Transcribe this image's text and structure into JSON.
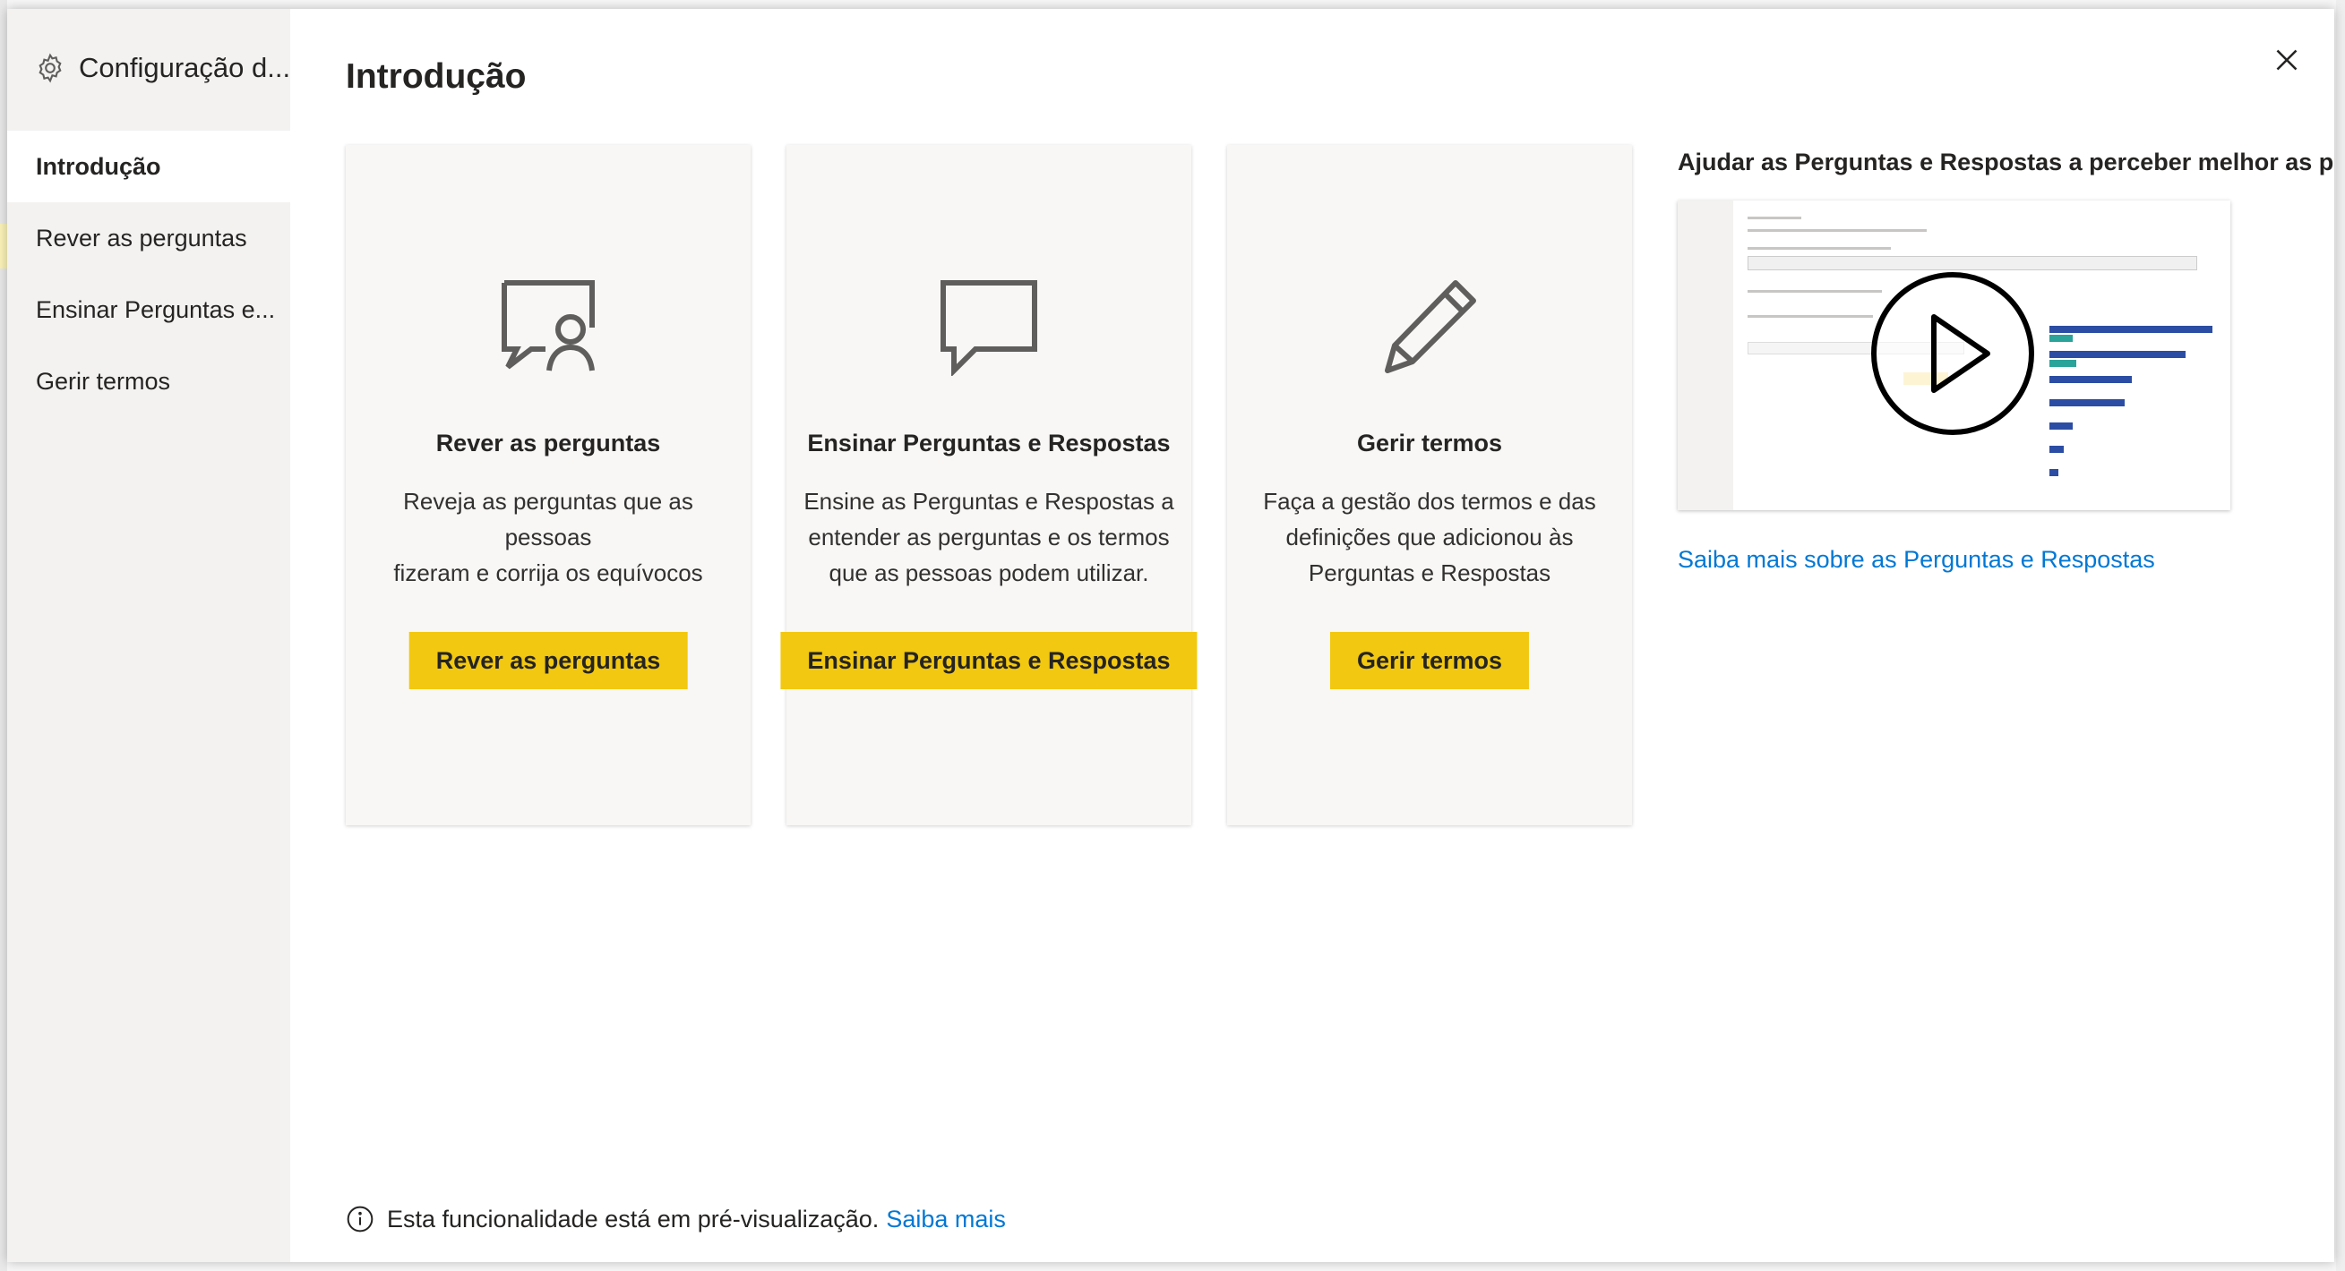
{
  "dialog": {
    "sidebar_title": "Configuração d...",
    "nav": [
      {
        "label": "Introdução",
        "active": true
      },
      {
        "label": "Rever as perguntas",
        "active": false
      },
      {
        "label": "Ensinar Perguntas e...",
        "active": false
      },
      {
        "label": "Gerir termos",
        "active": false
      }
    ],
    "page_title": "Introdução",
    "cards": [
      {
        "icon": "chat-person-icon",
        "title": "Rever as perguntas",
        "desc_line1": "Reveja as perguntas que as pessoas",
        "desc_line2": "fizeram e corrija os equívocos",
        "desc_line3": "",
        "button": "Rever as perguntas"
      },
      {
        "icon": "speech-bubble-icon",
        "title": "Ensinar Perguntas e Respostas",
        "desc_line1": "Ensine as Perguntas e Respostas a",
        "desc_line2": "entender as perguntas e os termos",
        "desc_line3": "que as pessoas podem utilizar.",
        "button": "Ensinar Perguntas e Respostas"
      },
      {
        "icon": "pencil-icon",
        "title": "Gerir termos",
        "desc_line1": "Faça a gestão dos termos e das",
        "desc_line2": "definições que adicionou às",
        "desc_line3": "Perguntas e Respostas",
        "button": "Gerir termos"
      }
    ],
    "video": {
      "heading": "Ajudar as Perguntas e Respostas a perceber melhor as pessoas",
      "link": "Saiba mais sobre as Perguntas e Respostas"
    },
    "footer": {
      "text": "Esta funcionalidade está em pré-visualização.",
      "link": "Saiba mais"
    }
  },
  "colors": {
    "accent_button": "#f2c811",
    "link": "#0078d4",
    "sidebar_bg": "#f3f2f1",
    "card_bg": "#f8f7f6"
  }
}
